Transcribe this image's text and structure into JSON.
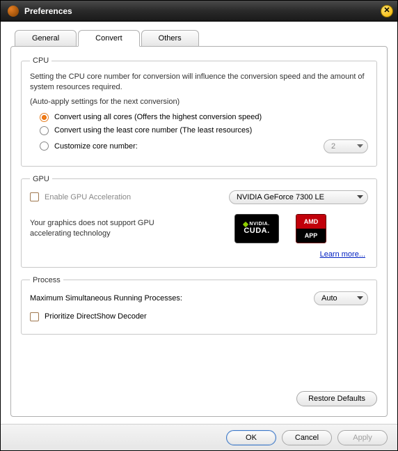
{
  "window": {
    "title": "Preferences"
  },
  "tabs": {
    "general": "General",
    "convert": "Convert",
    "others": "Others",
    "active": "convert"
  },
  "cpu": {
    "legend": "CPU",
    "description": "Setting the CPU core number for conversion will influence the conversion speed and the amount of system resources required.",
    "autoapply": "(Auto-apply settings for the next conversion)",
    "opt_all": "Convert using all cores (Offers the highest conversion speed)",
    "opt_least": "Convert using the least core number (The least resources)",
    "opt_custom": "Customize core number:",
    "custom_value": "2",
    "selected": "all"
  },
  "gpu": {
    "legend": "GPU",
    "enable_label": "Enable GPU Acceleration",
    "device": "NVIDIA GeForce 7300 LE",
    "unsupported": "Your graphics does not support GPU accelerating technology",
    "learn_more": "Learn more...",
    "badge_nvidia_top": "NVIDIA.",
    "badge_nvidia_bot": "CUDA.",
    "badge_amd_top": "AMD",
    "badge_amd_bot": "APP"
  },
  "process": {
    "legend": "Process",
    "max_label": "Maximum Simultaneous Running Processes:",
    "max_value": "Auto",
    "prioritize": "Prioritize DirectShow Decoder"
  },
  "buttons": {
    "restore": "Restore Defaults",
    "ok": "OK",
    "cancel": "Cancel",
    "apply": "Apply"
  }
}
